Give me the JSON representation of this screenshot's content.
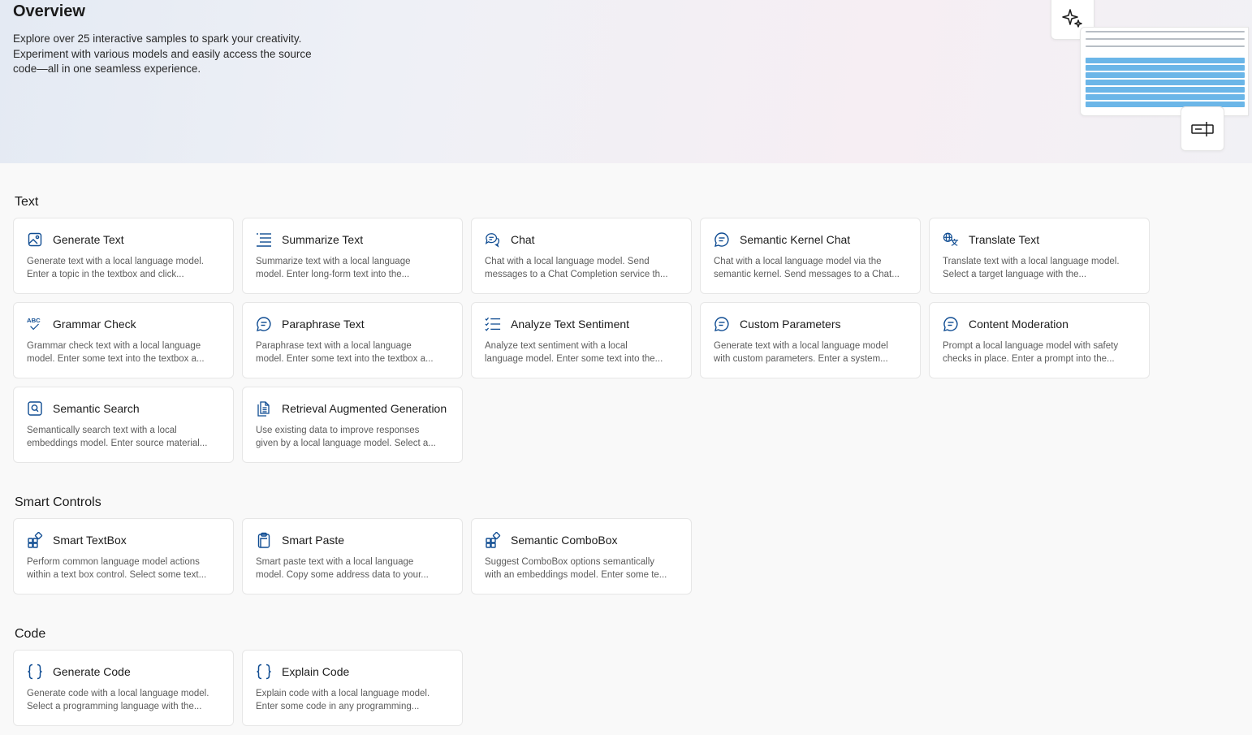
{
  "hero": {
    "title": "Overview",
    "desc_lines": [
      "Explore over 25 interactive samples to spark your creativity.",
      "Experiment with various models and easily access the source",
      "code—all in one seamless experience."
    ]
  },
  "sections": {
    "text": {
      "title": "Text",
      "cards": [
        {
          "title": "Generate Text",
          "icon": "image-icon",
          "desc": [
            "Generate text with a local language model.",
            "Enter a topic in the textbox and click..."
          ]
        },
        {
          "title": "Summarize Text",
          "icon": "list-icon",
          "desc": [
            "Summarize text with a local language",
            "model. Enter long-form text into the..."
          ]
        },
        {
          "title": "Chat",
          "icon": "chat-icon",
          "desc": [
            "Chat with a local language model. Send",
            "messages to a Chat Completion service th..."
          ]
        },
        {
          "title": "Semantic Kernel Chat",
          "icon": "chat-bubble-icon",
          "desc": [
            "Chat with a local language model via the",
            "semantic kernel. Send messages to a Chat..."
          ]
        },
        {
          "title": "Translate Text",
          "icon": "translate-icon",
          "desc": [
            "Translate text with a local language model.",
            "Select a target language with the..."
          ]
        },
        {
          "title": "Grammar Check",
          "icon": "spellcheck-icon",
          "desc": [
            "Grammar check text with a local language",
            "model. Enter some text into the textbox a..."
          ]
        },
        {
          "title": "Paraphrase Text",
          "icon": "chat-bubble-icon",
          "desc": [
            "Paraphrase text with a local language",
            "model. Enter some text into the textbox a..."
          ]
        },
        {
          "title": "Analyze Text Sentiment",
          "icon": "checklist-icon",
          "desc": [
            "Analyze text sentiment with a local",
            "language model. Enter some text into the..."
          ]
        },
        {
          "title": "Custom Parameters",
          "icon": "chat-bubble-icon",
          "desc": [
            "Generate text with a local language model",
            "with custom parameters. Enter a system..."
          ]
        },
        {
          "title": "Content Moderation",
          "icon": "chat-bubble-icon",
          "desc": [
            "Prompt a local language model with safety",
            "checks in place. Enter a prompt into the..."
          ]
        },
        {
          "title": "Semantic Search",
          "icon": "search-box-icon",
          "desc": [
            "Semantically search text with a local",
            "embeddings model. Enter source material..."
          ]
        },
        {
          "title": "Retrieval Augmented Generation",
          "icon": "documents-icon",
          "desc": [
            "Use existing data to improve responses",
            "given by a local language model. Select a..."
          ]
        }
      ]
    },
    "smart": {
      "title": "Smart Controls",
      "cards": [
        {
          "title": "Smart TextBox",
          "icon": "apps-add-icon",
          "desc": [
            "Perform common language model actions",
            "within a text box control. Select some text..."
          ]
        },
        {
          "title": "Smart Paste",
          "icon": "clipboard-icon",
          "desc": [
            "Smart paste text with a local language",
            "model. Copy some address data to your..."
          ]
        },
        {
          "title": "Semantic ComboBox",
          "icon": "apps-add-icon",
          "desc": [
            "Suggest ComboBox options semantically",
            "with an embeddings model. Enter some te..."
          ]
        }
      ]
    },
    "code": {
      "title": "Code",
      "cards": [
        {
          "title": "Generate Code",
          "icon": "braces-icon",
          "desc": [
            "Generate code with a local language model.",
            "Select a programming language with the..."
          ]
        },
        {
          "title": "Explain Code",
          "icon": "braces-icon",
          "desc": [
            "Explain code with a local language model.",
            "Enter some code in any programming..."
          ]
        }
      ]
    }
  },
  "colors": {
    "accent": "#0f4c92",
    "highlight": "#6bb6e8"
  }
}
